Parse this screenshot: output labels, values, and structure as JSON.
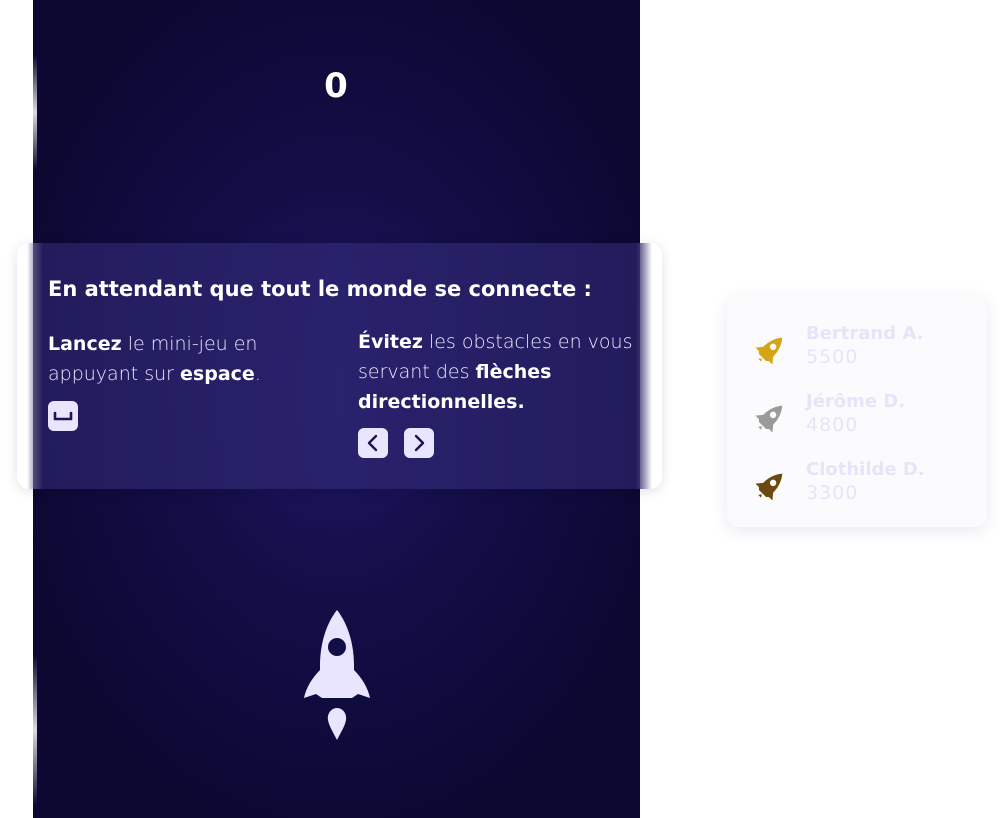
{
  "game": {
    "score": "0",
    "colors": {
      "background": "#140e48",
      "ship": "#e9e5ff"
    }
  },
  "overlay": {
    "title": "En attendant que tout le monde se connecte :",
    "launch": {
      "verb": "Lancez",
      "text_1": " le mini-jeu en appuyant sur ",
      "key_name": "espace",
      "text_2": ".",
      "key_icon": "space-bar-icon"
    },
    "avoid": {
      "verb": "Évitez",
      "text_1": " les obstacles en vous servant des ",
      "key_name": "flèches directionnelles.",
      "key_icons": [
        "arrow-left-icon",
        "arrow-right-icon"
      ]
    }
  },
  "leaderboard": {
    "entries": [
      {
        "name": "Bertrand A.",
        "score": "5500",
        "medal_color": "#d4a514",
        "icon": "rocket-gold-icon"
      },
      {
        "name": "Jérôme D.",
        "score": "4800",
        "medal_color": "#9a9a9a",
        "icon": "rocket-silver-icon"
      },
      {
        "name": "Clothilde D.",
        "score": "3300",
        "medal_color": "#6b4a10",
        "icon": "rocket-bronze-icon"
      }
    ]
  }
}
